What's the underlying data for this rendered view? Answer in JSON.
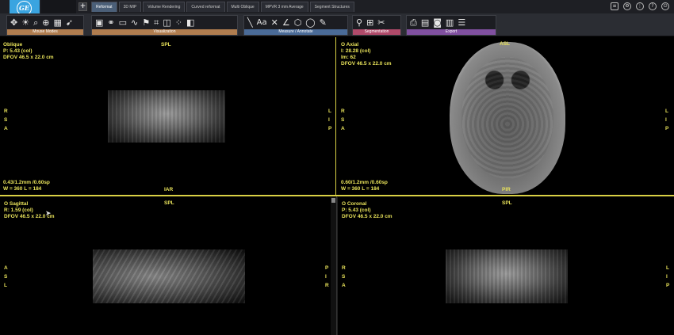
{
  "tabs": [
    {
      "label": "Reformat",
      "active": true
    },
    {
      "label": "3D MIP",
      "active": false
    },
    {
      "label": "Volume Rendering",
      "active": false
    },
    {
      "label": "Curved reformat",
      "active": false
    },
    {
      "label": "Multi Oblique",
      "active": false
    },
    {
      "label": "MPVR 3 mm Average",
      "active": false
    },
    {
      "label": "Segment Structures",
      "active": false
    }
  ],
  "add_tab_label": "+",
  "toolbar": {
    "groups": [
      {
        "label": "Mouse Modes",
        "icons": [
          "arrows-icon",
          "brightness-icon",
          "zoom-icon",
          "zoom-plus-icon",
          "grid-icon",
          "pointer-icon"
        ]
      },
      {
        "label": "Visualization",
        "icons": [
          "screen-icon",
          "link-icon",
          "window-icon",
          "curve-icon",
          "flag-icon",
          "crop-icon",
          "box-icon",
          "dots-icon",
          "layers-icon"
        ]
      },
      {
        "label": "Measure / Annotate",
        "icons": [
          "line-icon",
          "text-icon",
          "cross-icon",
          "angle-icon",
          "roi-icon",
          "ellipse-icon",
          "freehand-icon"
        ]
      },
      {
        "label": "Segmentation",
        "icons": [
          "seed-icon",
          "add-region-icon",
          "cut-icon"
        ]
      },
      {
        "label": "Export",
        "icons": [
          "print-icon",
          "save-icon",
          "camera-icon",
          "film-icon",
          "list-icon"
        ]
      }
    ]
  },
  "viewports": {
    "top_left": {
      "title": "Oblique",
      "line2": "P: 5.43 (col)",
      "line3": "DFOV 46.5 x 22.0 cm",
      "top_label": "SPL",
      "bottom_label": "IAR",
      "left_orient": "R\nS\nA",
      "right_orient": "L\nI\nP",
      "bottom_info1": "0.43/1.2mm /0.60sp",
      "bottom_info2": "W = 360 L = 184"
    },
    "top_right": {
      "title": "O Axial",
      "line2": "I: 28.28 (col)",
      "line3": "Im: 62",
      "line4": "DFOV 46.5 x 22.0 cm",
      "top_label": "ASL",
      "bottom_label": "PIR",
      "left_orient": "R\nS\nA",
      "right_orient": "L\nI\nP",
      "bottom_info1": "0.60/1.2mm /0.60sp",
      "bottom_info2": "W = 360 L = 184"
    },
    "bottom_left": {
      "title": "O Sagittal",
      "line2": "R: 1.59 (col)",
      "line3": "DFOV 46.5 x 22.0 cm",
      "top_label": "SPL",
      "left_orient": "A\nS\nL",
      "right_orient": "P\nI\nR"
    },
    "bottom_right": {
      "title": "O Coronal",
      "line2": "P: 5.43 (col)",
      "line3": "DFOV 46.5 x 22.0 cm",
      "top_label": "SPL",
      "left_orient": "R\nS\nA",
      "right_orient": "L\nI\nP"
    }
  }
}
